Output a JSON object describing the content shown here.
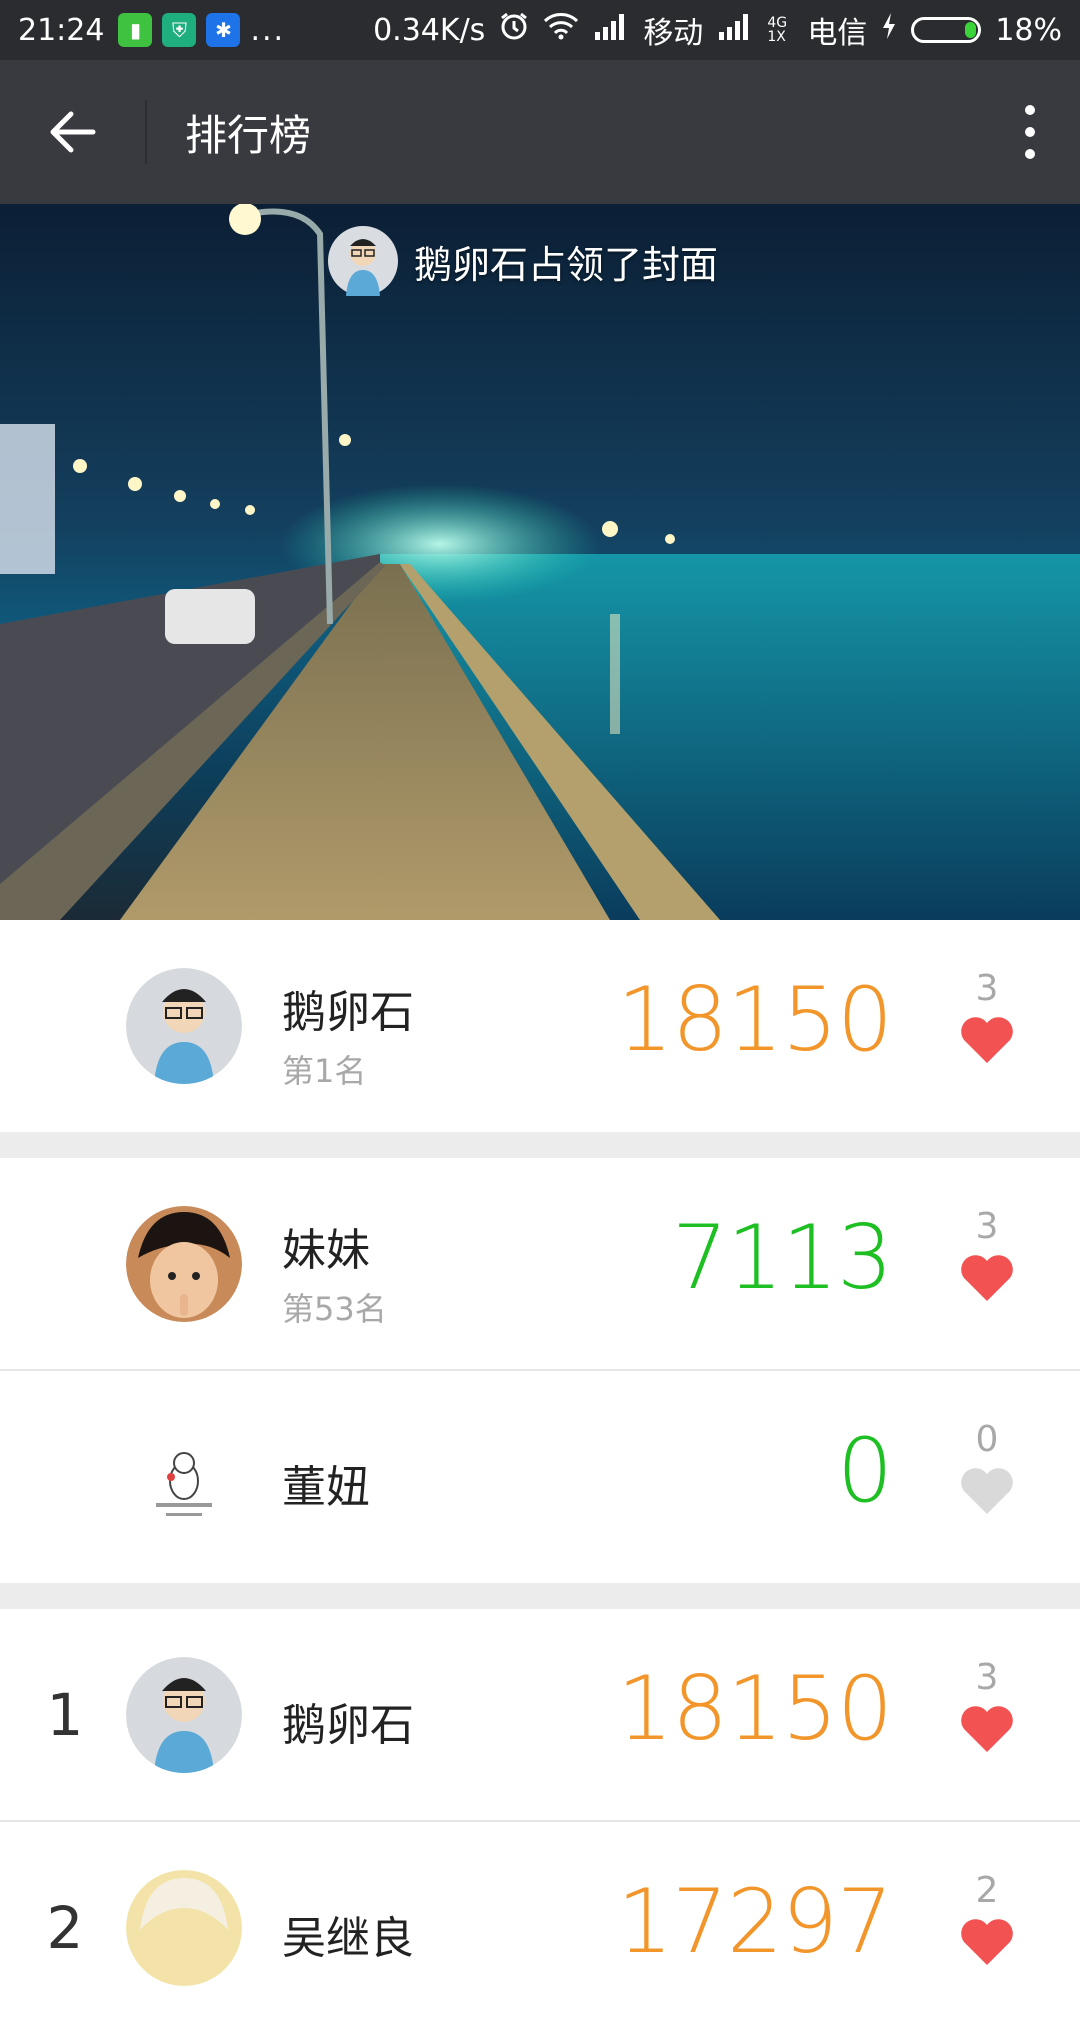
{
  "status_bar": {
    "time": "21:24",
    "dots": "...",
    "speed": "0.34K/s",
    "carrier1": "移动",
    "network_label": "4G 1X",
    "carrier2": "电信",
    "battery": "18%",
    "battery_fraction": 0.18
  },
  "header": {
    "title": "排行榜"
  },
  "cover": {
    "caption": "鹅卵石占领了封面"
  },
  "summary_rows": [
    {
      "name": "鹅卵石",
      "subtitle": "第1名",
      "score": "18150",
      "likes": "3",
      "liked": true,
      "score_color": "#f2962b"
    },
    {
      "name": "妹妹",
      "subtitle": "第53名",
      "score": "7113",
      "likes": "3",
      "liked": true,
      "score_color": "#1dbf22"
    },
    {
      "name": "董妞",
      "subtitle": "",
      "score": "0",
      "likes": "0",
      "liked": false,
      "score_color": "#1dbf22"
    }
  ],
  "ranking_rows": [
    {
      "rank": "1",
      "name": "鹅卵石",
      "score": "18150",
      "likes": "3",
      "liked": true,
      "score_color": "#f2962b"
    },
    {
      "rank": "2",
      "name": "吴继良",
      "score": "17297",
      "likes": "2",
      "liked": true,
      "score_color": "#f2962b"
    }
  ],
  "colors": {
    "status_bg": "#2a2c2f",
    "appbar_bg": "#393a3f",
    "heart_active": "#f25252",
    "heart_inactive": "#d9d9d9",
    "orange": "#f2962b",
    "green": "#1dbf22"
  },
  "icons": [
    "back-arrow-icon",
    "more-vert-icon",
    "heart-icon",
    "alarm-icon",
    "wifi-icon",
    "signal-icon",
    "battery-icon",
    "charging-icon"
  ]
}
